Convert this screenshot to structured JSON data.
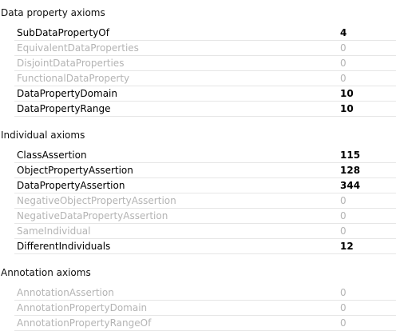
{
  "sections": [
    {
      "title": "Data property axioms",
      "rows": [
        {
          "label": "SubDataPropertyOf",
          "count": "4",
          "active": true
        },
        {
          "label": "EquivalentDataProperties",
          "count": "0",
          "active": false
        },
        {
          "label": "DisjointDataProperties",
          "count": "0",
          "active": false
        },
        {
          "label": "FunctionalDataProperty",
          "count": "0",
          "active": false
        },
        {
          "label": "DataPropertyDomain",
          "count": "10",
          "active": true
        },
        {
          "label": "DataPropertyRange",
          "count": "10",
          "active": true
        }
      ]
    },
    {
      "title": "Individual axioms",
      "rows": [
        {
          "label": "ClassAssertion",
          "count": "115",
          "active": true
        },
        {
          "label": "ObjectPropertyAssertion",
          "count": "128",
          "active": true
        },
        {
          "label": "DataPropertyAssertion",
          "count": "344",
          "active": true
        },
        {
          "label": "NegativeObjectPropertyAssertion",
          "count": "0",
          "active": false
        },
        {
          "label": "NegativeDataPropertyAssertion",
          "count": "0",
          "active": false
        },
        {
          "label": "SameIndividual",
          "count": "0",
          "active": false
        },
        {
          "label": "DifferentIndividuals",
          "count": "12",
          "active": true
        }
      ]
    },
    {
      "title": "Annotation axioms",
      "rows": [
        {
          "label": "AnnotationAssertion",
          "count": "0",
          "active": false
        },
        {
          "label": "AnnotationPropertyDomain",
          "count": "0",
          "active": false
        },
        {
          "label": "AnnotationPropertyRangeOf",
          "count": "0",
          "active": false
        }
      ]
    }
  ]
}
